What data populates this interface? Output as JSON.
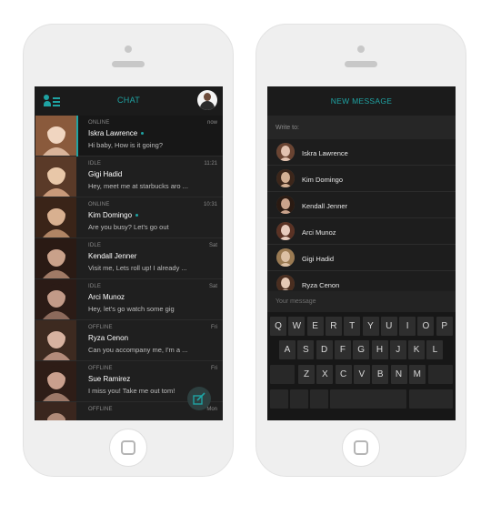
{
  "chat_screen": {
    "title": "CHAT",
    "conversations": [
      {
        "status": "ONLINE",
        "time": "now",
        "name": "Iskra Lawrence",
        "online": true,
        "message": "Hi baby, How is it going?"
      },
      {
        "status": "IDLE",
        "time": "11:21",
        "name": "Gigi Hadid",
        "online": false,
        "message": "Hey, meet me at starbucks aro ..."
      },
      {
        "status": "ONLINE",
        "time": "10:31",
        "name": "Kim Domingo",
        "online": true,
        "message": "Are you busy? Let's go out"
      },
      {
        "status": "IDLE",
        "time": "Sat",
        "name": "Kendall Jenner",
        "online": false,
        "message": "Visit me, Lets roll up! I already ..."
      },
      {
        "status": "IDLE",
        "time": "Sat",
        "name": "Arci Munoz",
        "online": false,
        "message": "Hey, let's go watch some gig"
      },
      {
        "status": "OFFLINE",
        "time": "Fri",
        "name": "Ryza Cenon",
        "online": false,
        "message": "Can you accompany me, I'm a ..."
      },
      {
        "status": "OFFLINE",
        "time": "Fri",
        "name": "Sue Ramirez",
        "online": false,
        "message": "I miss you! Take me out tom!"
      },
      {
        "status": "OFFLINE",
        "time": "Mon",
        "name": "",
        "online": false,
        "message": ""
      }
    ]
  },
  "new_message_screen": {
    "title": "NEW MESSAGE",
    "write_to_label": "Write to:",
    "contacts": [
      "Iskra Lawrence",
      "Kim Domingo",
      "Kendall Jenner",
      "Arci Munoz",
      "Gigi Hadid",
      "Ryza Cenon"
    ],
    "message_placeholder": "Your message",
    "keyboard": {
      "row1": [
        "Q",
        "W",
        "E",
        "R",
        "T",
        "Y",
        "U",
        "I",
        "O",
        "P"
      ],
      "row2": [
        "A",
        "S",
        "D",
        "F",
        "G",
        "H",
        "J",
        "K",
        "L"
      ],
      "row3": [
        "Z",
        "X",
        "C",
        "V",
        "B",
        "N",
        "M"
      ]
    }
  },
  "colors": {
    "accent": "#1fa3a3",
    "screen_bg": "#1e1e1e",
    "phone_frame": "#efefef"
  },
  "icons": [
    "menu-icon",
    "profile-avatar",
    "compose-icon",
    "home-button",
    "online-dot"
  ]
}
